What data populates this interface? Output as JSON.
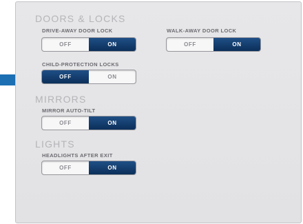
{
  "sections": {
    "doors": {
      "title": "DOORS & LOCKS",
      "drive_away": {
        "label": "DRIVE-AWAY DOOR LOCK",
        "off": "OFF",
        "on": "ON"
      },
      "walk_away": {
        "label": "WALK-AWAY DOOR LOCK",
        "off": "OFF",
        "on": "ON"
      },
      "child": {
        "label": "CHILD-PROTECTION LOCKS",
        "off": "OFF",
        "on": "ON"
      }
    },
    "mirrors": {
      "title": "MIRRORS",
      "auto_tilt": {
        "label": "MIRROR AUTO-TILT",
        "off": "OFF",
        "on": "ON"
      }
    },
    "lights": {
      "title": "LIGHTS",
      "headlights": {
        "label": "HEADLIGHTS AFTER EXIT",
        "off": "OFF",
        "on": "ON"
      }
    }
  },
  "toggle_states": {
    "drive_away": "ON",
    "walk_away": "ON",
    "child": "OFF",
    "auto_tilt": "ON",
    "headlights": "ON"
  },
  "colors": {
    "active_segment": "#0c2f5a",
    "pointer_arrow": "#1c6fb3"
  },
  "icons": {
    "pointer": "arrow-right-icon"
  }
}
